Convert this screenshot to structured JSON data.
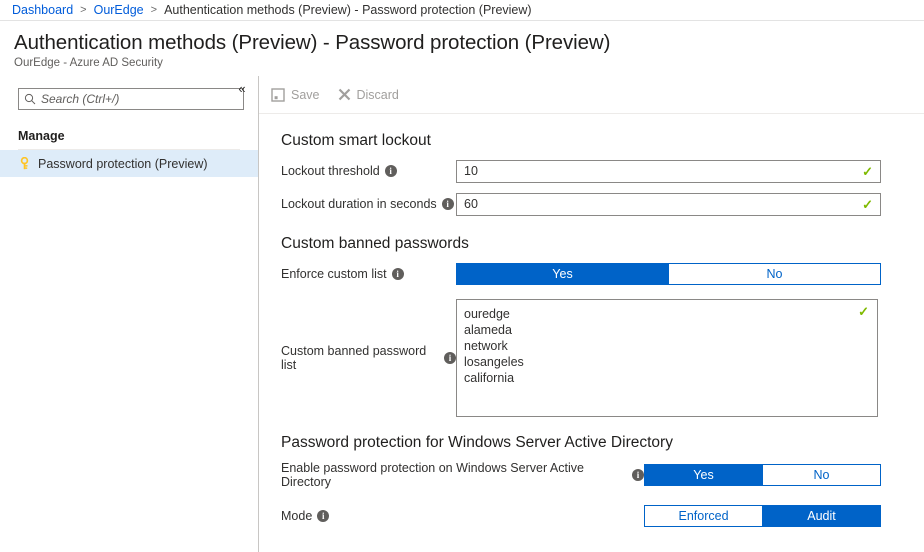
{
  "breadcrumb": {
    "items": [
      {
        "label": "Dashboard",
        "type": "link"
      },
      {
        "label": "OurEdge",
        "type": "link"
      },
      {
        "label": "Authentication methods (Preview) - Password protection (Preview)",
        "type": "current"
      }
    ],
    "separator": ">"
  },
  "header": {
    "title": "Authentication methods (Preview) - Password protection (Preview)",
    "subtitle": "OurEdge - Azure AD Security"
  },
  "sidebar": {
    "collapse_glyph": "«",
    "search": {
      "placeholder": "Search (Ctrl+/)",
      "value": "",
      "icon": "search-icon"
    },
    "section_label": "Manage",
    "items": [
      {
        "label": "Password protection (Preview)",
        "icon": "key-icon",
        "selected": true
      }
    ]
  },
  "toolbar": {
    "save_label": "Save",
    "discard_label": "Discard"
  },
  "main": {
    "sections": [
      {
        "title": "Custom smart lockout",
        "fields": [
          {
            "label": "Lockout threshold",
            "value": "10",
            "valid": true
          },
          {
            "label": "Lockout duration in seconds",
            "value": "60",
            "valid": true
          }
        ]
      },
      {
        "title": "Custom banned passwords",
        "enforce_label": "Enforce custom list",
        "enforce_options": [
          "Yes",
          "No"
        ],
        "enforce_selected": "Yes",
        "list_label": "Custom banned password list",
        "list_value": "ouredge\nalameda\nnetwork\nlosangeles\ncalifornia",
        "list_valid": true
      },
      {
        "title": "Password protection for Windows Server Active Directory",
        "enable_label": "Enable password protection on Windows Server Active Directory",
        "enable_options": [
          "Yes",
          "No"
        ],
        "enable_selected": "Yes",
        "mode_label": "Mode",
        "mode_options": [
          "Enforced",
          "Audit"
        ],
        "mode_selected": "Audit"
      }
    ]
  },
  "colors": {
    "accent_blue": "#0063c8",
    "link_blue": "#015cda",
    "valid_green": "#7fba00",
    "selected_nav": "#deecf9",
    "key_icon": "#ffc425"
  }
}
